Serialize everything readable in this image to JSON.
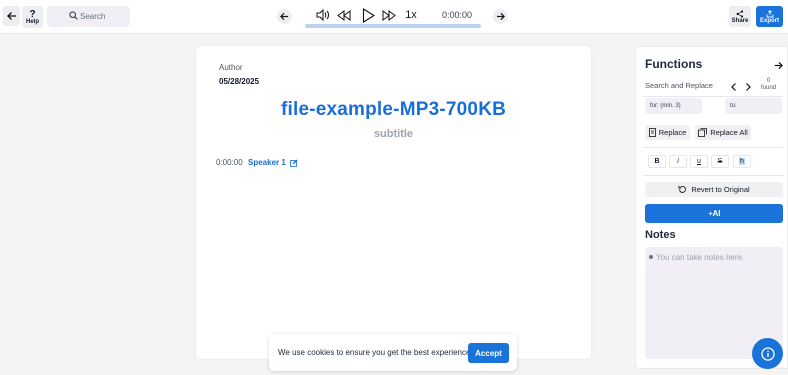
{
  "topbar": {
    "help_label": "Help",
    "search_placeholder": "Search",
    "speed": "1x",
    "time": "0:00:00",
    "share_label": "Share",
    "export_label": "Export"
  },
  "document": {
    "author_label": "Author",
    "date": "05/28/2025",
    "title": "file-example-MP3-700KB",
    "subtitle": "subtitle",
    "segments": [
      {
        "timestamp": "0:00:00",
        "speaker": "Speaker 1"
      }
    ]
  },
  "functions": {
    "title": "Functions",
    "search_replace_label": "Search and Replace",
    "found_count": "0",
    "found_label": "found",
    "for_placeholder": "for: (min. 3)",
    "to_placeholder": "to:",
    "replace_label": "Replace",
    "replace_all_label": "Replace All",
    "format_bold": "B",
    "format_italic": "i",
    "format_underline": "u",
    "format_strike": "S",
    "format_highlight": "h",
    "revert_label": "Revert to Original",
    "ai_label": "AI",
    "notes_title": "Notes",
    "notes_placeholder": "You can take notes here."
  },
  "cookie": {
    "text": "We use cookies to ensure you get the best experience.",
    "accept_label": "Accept"
  },
  "colors": {
    "accent": "#1a73d9",
    "title_blue": "#1a6fd6",
    "progress": "#bcd3ee"
  },
  "icons": [
    "arrow-left-icon",
    "question-icon",
    "search-icon",
    "volume-icon",
    "rewind-icon",
    "play-icon",
    "fast-forward-icon",
    "arrow-right-icon",
    "share-icon",
    "export-icon",
    "edit-icon",
    "chevron-left-icon",
    "chevron-right-icon",
    "replace-icon",
    "replace-all-icon",
    "revert-icon",
    "sparkle-icon",
    "info-icon"
  ]
}
